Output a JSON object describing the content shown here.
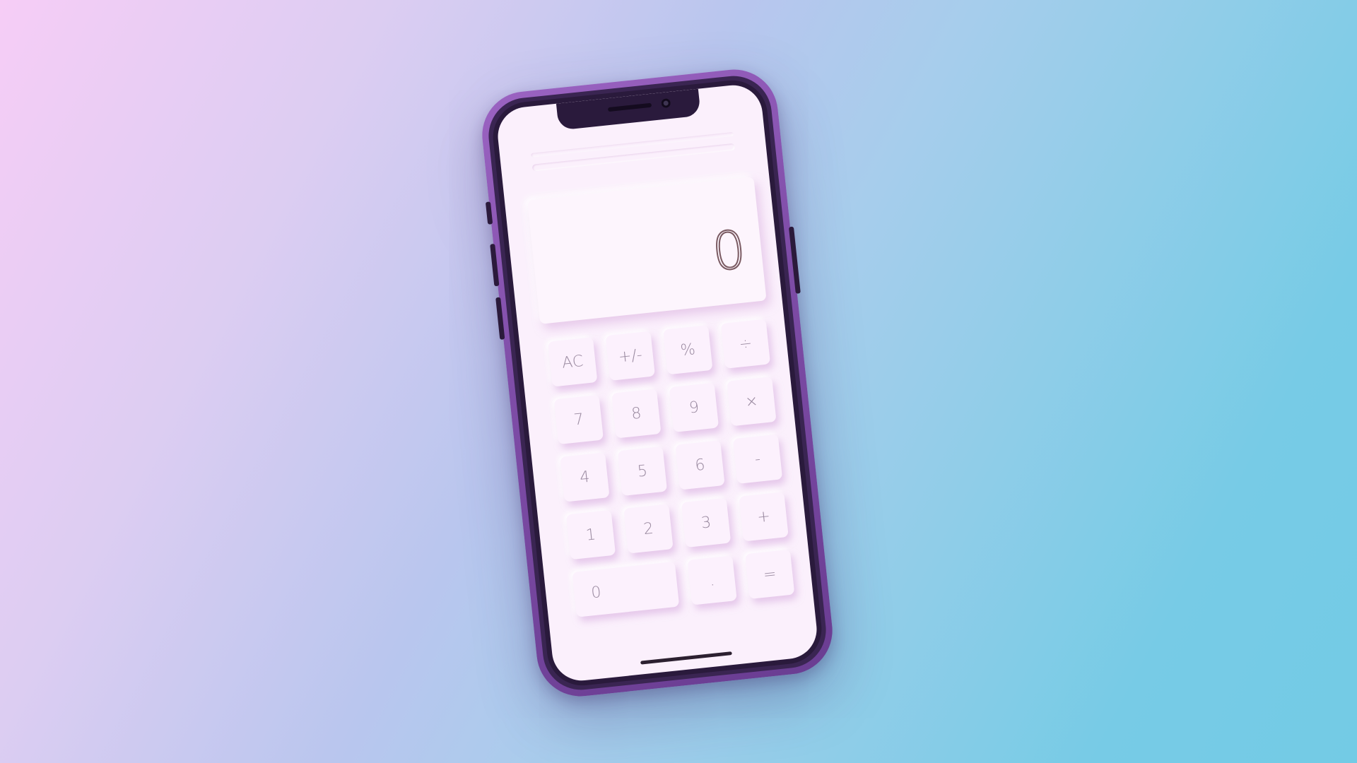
{
  "calculator": {
    "display": {
      "value": "0"
    },
    "keys": {
      "ac": "AC",
      "sign": "+/-",
      "percent": "%",
      "divide": "÷",
      "seven": "7",
      "eight": "8",
      "nine": "9",
      "multiply": "×",
      "four": "4",
      "five": "5",
      "six": "6",
      "subtract": "-",
      "one": "1",
      "two": "2",
      "three": "3",
      "add": "+",
      "zero": "0",
      "decimal": ".",
      "equals": "="
    }
  },
  "colors": {
    "background_left": "#f6cdf6",
    "background_right": "#73cbe5",
    "phone_frame": "#7f4da8",
    "screen": "#fbf0fc",
    "key_text": "#9a8aa0",
    "display_text": "#7a5a62"
  }
}
